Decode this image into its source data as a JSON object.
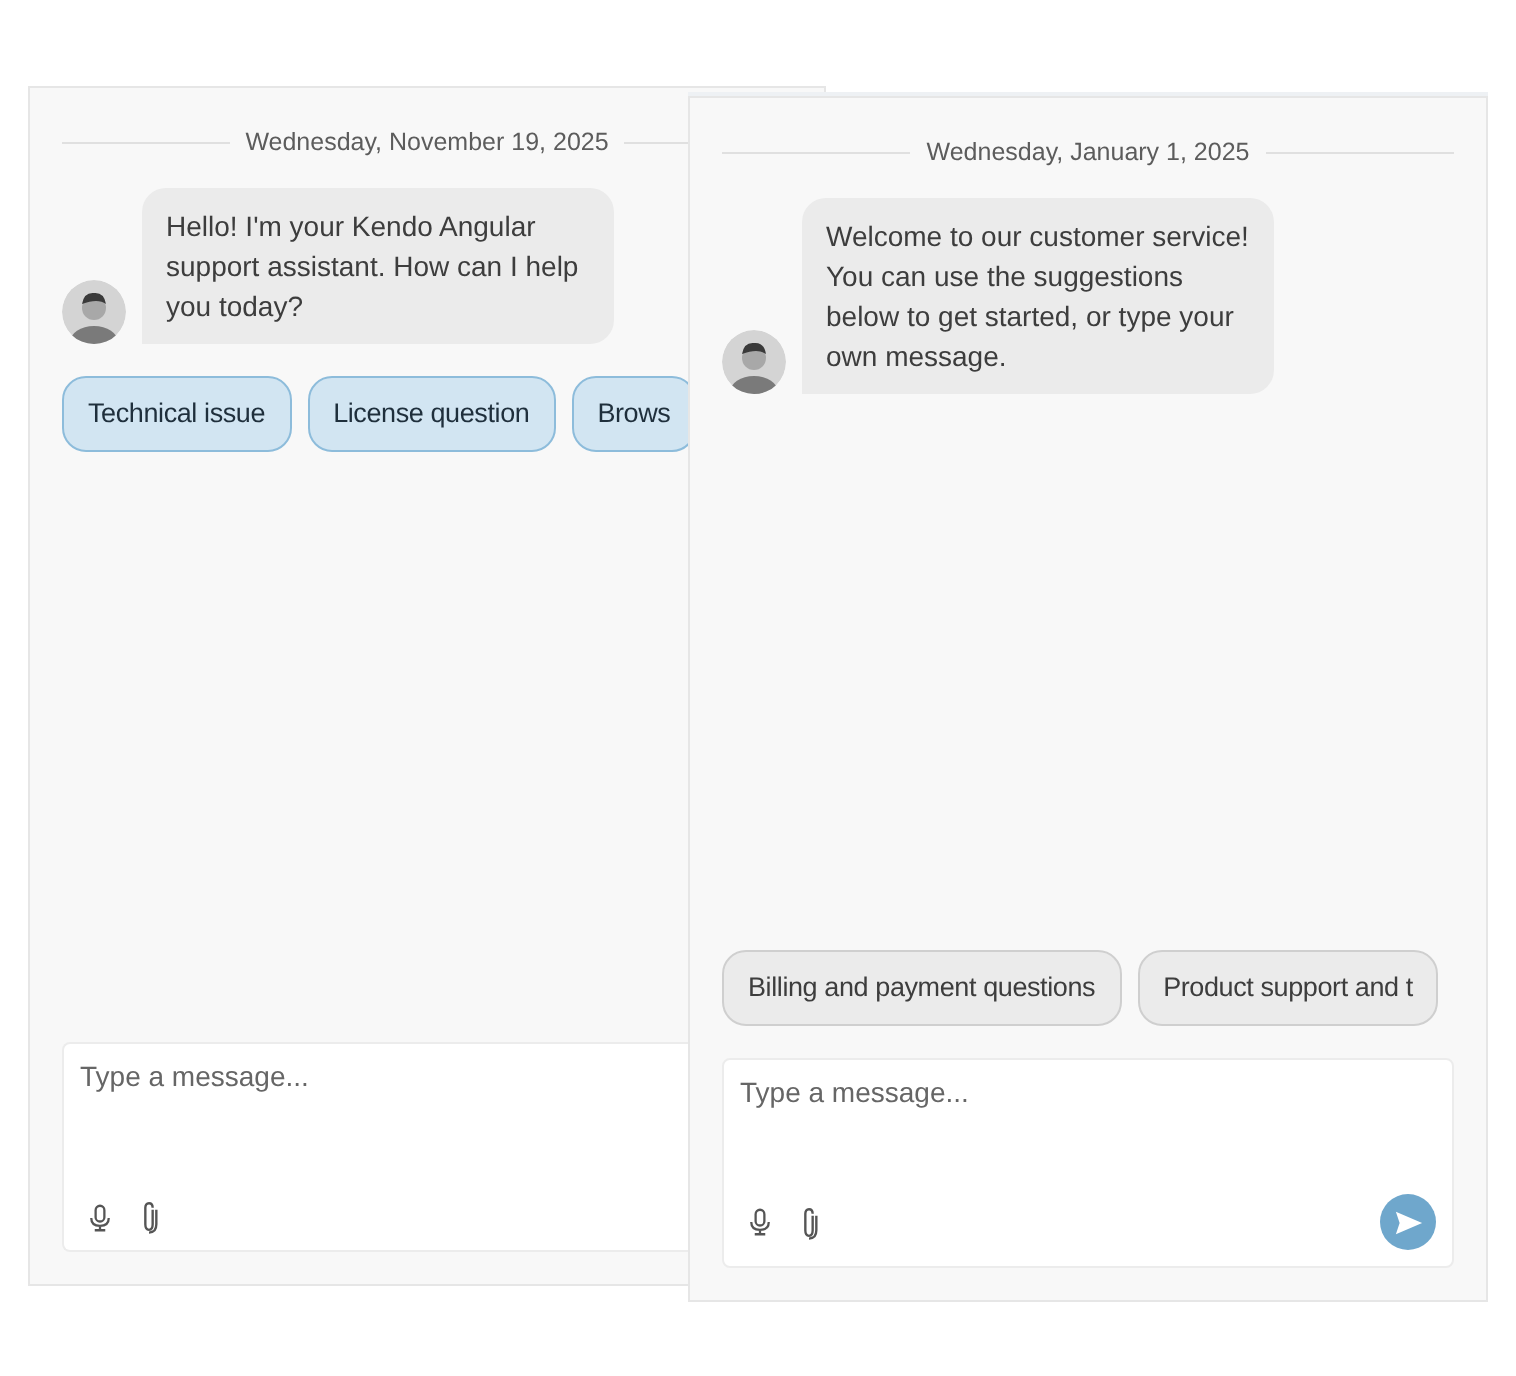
{
  "windows": [
    {
      "date": "Wednesday, November 19, 2025",
      "messages": [
        {
          "text": "Hello! I'm your Kendo Angular support assistant. How can I help you today?",
          "suggested_actions": [
            "Technical issue",
            "License question",
            "Brows"
          ]
        }
      ],
      "input": {
        "placeholder": "Type a message..."
      }
    },
    {
      "date": "Wednesday, January 1, 2025",
      "messages": [
        {
          "text": "Welcome to our customer service! You can use the suggestions below to get started, or type your own message."
        }
      ],
      "prompt_suggestions": [
        "Billing and payment questions",
        "Product support and t"
      ],
      "input": {
        "placeholder": "Type a message...",
        "send_button": true
      }
    }
  ]
}
